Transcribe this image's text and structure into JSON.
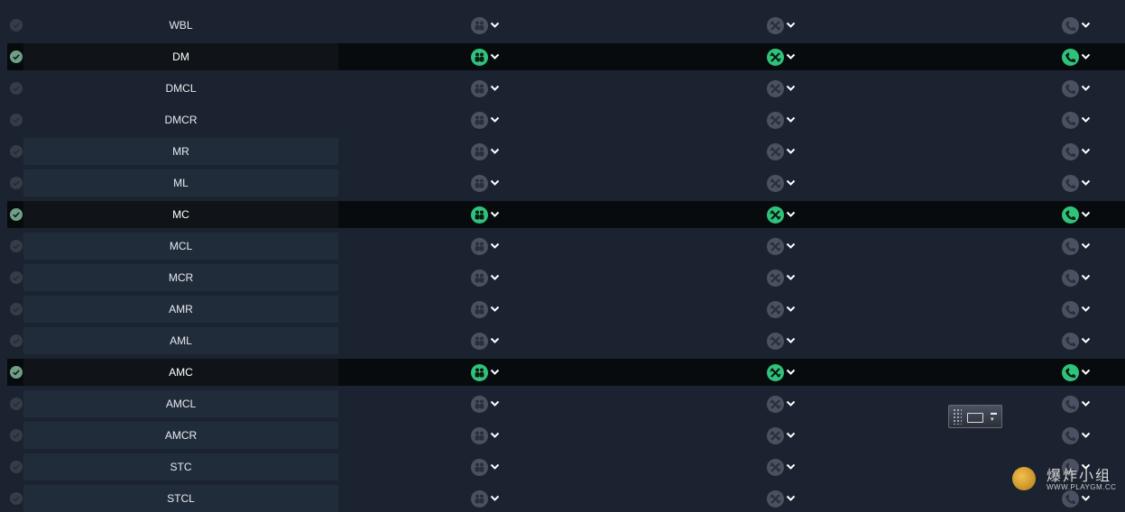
{
  "colors": {
    "background": "#1c2330",
    "active_row": "#080b0e",
    "accent_green": "#2fc27a",
    "inactive_icon": "#4a5261"
  },
  "icons": {
    "col1": "team-icon",
    "col2": "crossed-arrows-icon",
    "col3": "phone-icon",
    "check": "check-circle-icon",
    "dropdown": "chevron-down-icon"
  },
  "rows": [
    {
      "label": "WBL",
      "active": false,
      "tile": false
    },
    {
      "label": "DM",
      "active": true,
      "tile": true
    },
    {
      "label": "DMCL",
      "active": false,
      "tile": false
    },
    {
      "label": "DMCR",
      "active": false,
      "tile": false
    },
    {
      "label": "MR",
      "active": false,
      "tile": true
    },
    {
      "label": "ML",
      "active": false,
      "tile": true
    },
    {
      "label": "MC",
      "active": true,
      "tile": true
    },
    {
      "label": "MCL",
      "active": false,
      "tile": true
    },
    {
      "label": "MCR",
      "active": false,
      "tile": true
    },
    {
      "label": "AMR",
      "active": false,
      "tile": true
    },
    {
      "label": "AML",
      "active": false,
      "tile": true
    },
    {
      "label": "AMC",
      "active": true,
      "tile": true
    },
    {
      "label": "AMCL",
      "active": false,
      "tile": true
    },
    {
      "label": "AMCR",
      "active": false,
      "tile": true
    },
    {
      "label": "STC",
      "active": false,
      "tile": true
    },
    {
      "label": "STCL",
      "active": false,
      "tile": true
    }
  ],
  "watermark": {
    "title": "爆炸小组",
    "url": "WWW.PLAYGM.CC"
  }
}
